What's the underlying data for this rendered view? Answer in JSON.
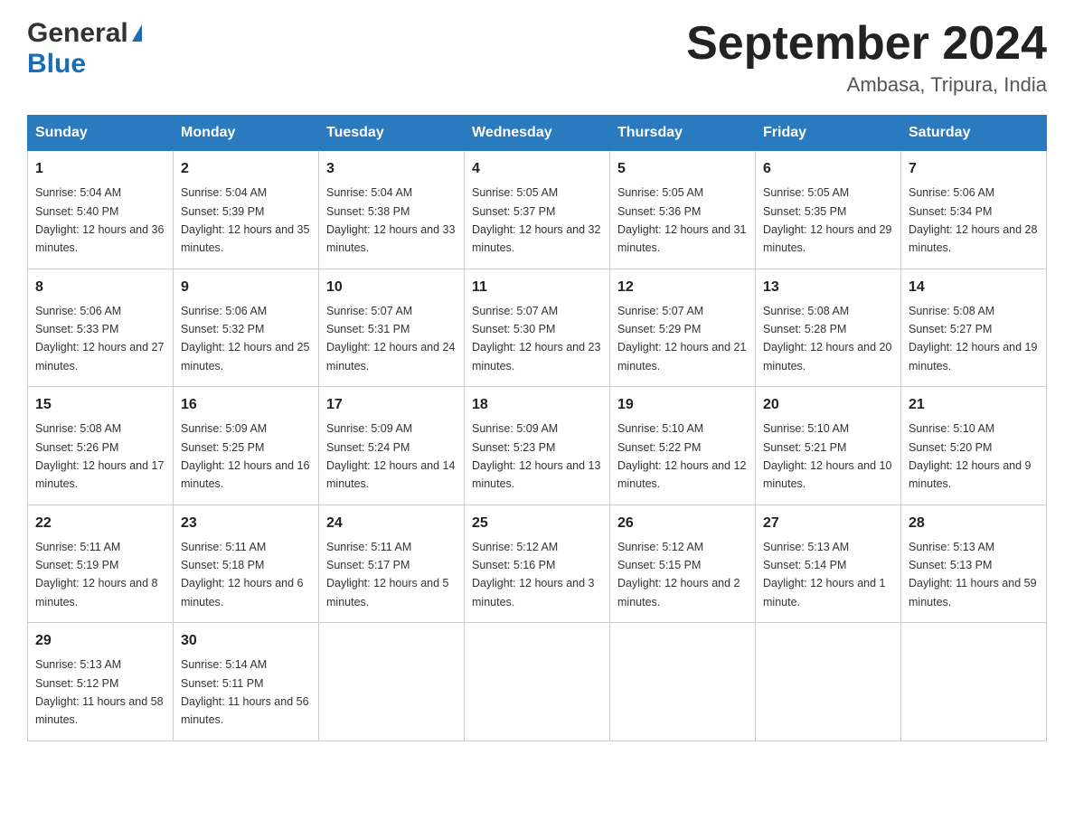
{
  "header": {
    "logo_general": "General",
    "logo_blue": "Blue",
    "month_title": "September 2024",
    "location": "Ambasa, Tripura, India"
  },
  "weekdays": [
    "Sunday",
    "Monday",
    "Tuesday",
    "Wednesday",
    "Thursday",
    "Friday",
    "Saturday"
  ],
  "weeks": [
    [
      {
        "day": "1",
        "sunrise": "5:04 AM",
        "sunset": "5:40 PM",
        "daylight": "12 hours and 36 minutes."
      },
      {
        "day": "2",
        "sunrise": "5:04 AM",
        "sunset": "5:39 PM",
        "daylight": "12 hours and 35 minutes."
      },
      {
        "day": "3",
        "sunrise": "5:04 AM",
        "sunset": "5:38 PM",
        "daylight": "12 hours and 33 minutes."
      },
      {
        "day": "4",
        "sunrise": "5:05 AM",
        "sunset": "5:37 PM",
        "daylight": "12 hours and 32 minutes."
      },
      {
        "day": "5",
        "sunrise": "5:05 AM",
        "sunset": "5:36 PM",
        "daylight": "12 hours and 31 minutes."
      },
      {
        "day": "6",
        "sunrise": "5:05 AM",
        "sunset": "5:35 PM",
        "daylight": "12 hours and 29 minutes."
      },
      {
        "day": "7",
        "sunrise": "5:06 AM",
        "sunset": "5:34 PM",
        "daylight": "12 hours and 28 minutes."
      }
    ],
    [
      {
        "day": "8",
        "sunrise": "5:06 AM",
        "sunset": "5:33 PM",
        "daylight": "12 hours and 27 minutes."
      },
      {
        "day": "9",
        "sunrise": "5:06 AM",
        "sunset": "5:32 PM",
        "daylight": "12 hours and 25 minutes."
      },
      {
        "day": "10",
        "sunrise": "5:07 AM",
        "sunset": "5:31 PM",
        "daylight": "12 hours and 24 minutes."
      },
      {
        "day": "11",
        "sunrise": "5:07 AM",
        "sunset": "5:30 PM",
        "daylight": "12 hours and 23 minutes."
      },
      {
        "day": "12",
        "sunrise": "5:07 AM",
        "sunset": "5:29 PM",
        "daylight": "12 hours and 21 minutes."
      },
      {
        "day": "13",
        "sunrise": "5:08 AM",
        "sunset": "5:28 PM",
        "daylight": "12 hours and 20 minutes."
      },
      {
        "day": "14",
        "sunrise": "5:08 AM",
        "sunset": "5:27 PM",
        "daylight": "12 hours and 19 minutes."
      }
    ],
    [
      {
        "day": "15",
        "sunrise": "5:08 AM",
        "sunset": "5:26 PM",
        "daylight": "12 hours and 17 minutes."
      },
      {
        "day": "16",
        "sunrise": "5:09 AM",
        "sunset": "5:25 PM",
        "daylight": "12 hours and 16 minutes."
      },
      {
        "day": "17",
        "sunrise": "5:09 AM",
        "sunset": "5:24 PM",
        "daylight": "12 hours and 14 minutes."
      },
      {
        "day": "18",
        "sunrise": "5:09 AM",
        "sunset": "5:23 PM",
        "daylight": "12 hours and 13 minutes."
      },
      {
        "day": "19",
        "sunrise": "5:10 AM",
        "sunset": "5:22 PM",
        "daylight": "12 hours and 12 minutes."
      },
      {
        "day": "20",
        "sunrise": "5:10 AM",
        "sunset": "5:21 PM",
        "daylight": "12 hours and 10 minutes."
      },
      {
        "day": "21",
        "sunrise": "5:10 AM",
        "sunset": "5:20 PM",
        "daylight": "12 hours and 9 minutes."
      }
    ],
    [
      {
        "day": "22",
        "sunrise": "5:11 AM",
        "sunset": "5:19 PM",
        "daylight": "12 hours and 8 minutes."
      },
      {
        "day": "23",
        "sunrise": "5:11 AM",
        "sunset": "5:18 PM",
        "daylight": "12 hours and 6 minutes."
      },
      {
        "day": "24",
        "sunrise": "5:11 AM",
        "sunset": "5:17 PM",
        "daylight": "12 hours and 5 minutes."
      },
      {
        "day": "25",
        "sunrise": "5:12 AM",
        "sunset": "5:16 PM",
        "daylight": "12 hours and 3 minutes."
      },
      {
        "day": "26",
        "sunrise": "5:12 AM",
        "sunset": "5:15 PM",
        "daylight": "12 hours and 2 minutes."
      },
      {
        "day": "27",
        "sunrise": "5:13 AM",
        "sunset": "5:14 PM",
        "daylight": "12 hours and 1 minute."
      },
      {
        "day": "28",
        "sunrise": "5:13 AM",
        "sunset": "5:13 PM",
        "daylight": "11 hours and 59 minutes."
      }
    ],
    [
      {
        "day": "29",
        "sunrise": "5:13 AM",
        "sunset": "5:12 PM",
        "daylight": "11 hours and 58 minutes."
      },
      {
        "day": "30",
        "sunrise": "5:14 AM",
        "sunset": "5:11 PM",
        "daylight": "11 hours and 56 minutes."
      },
      null,
      null,
      null,
      null,
      null
    ]
  ],
  "labels": {
    "sunrise": "Sunrise:",
    "sunset": "Sunset:",
    "daylight": "Daylight:"
  }
}
